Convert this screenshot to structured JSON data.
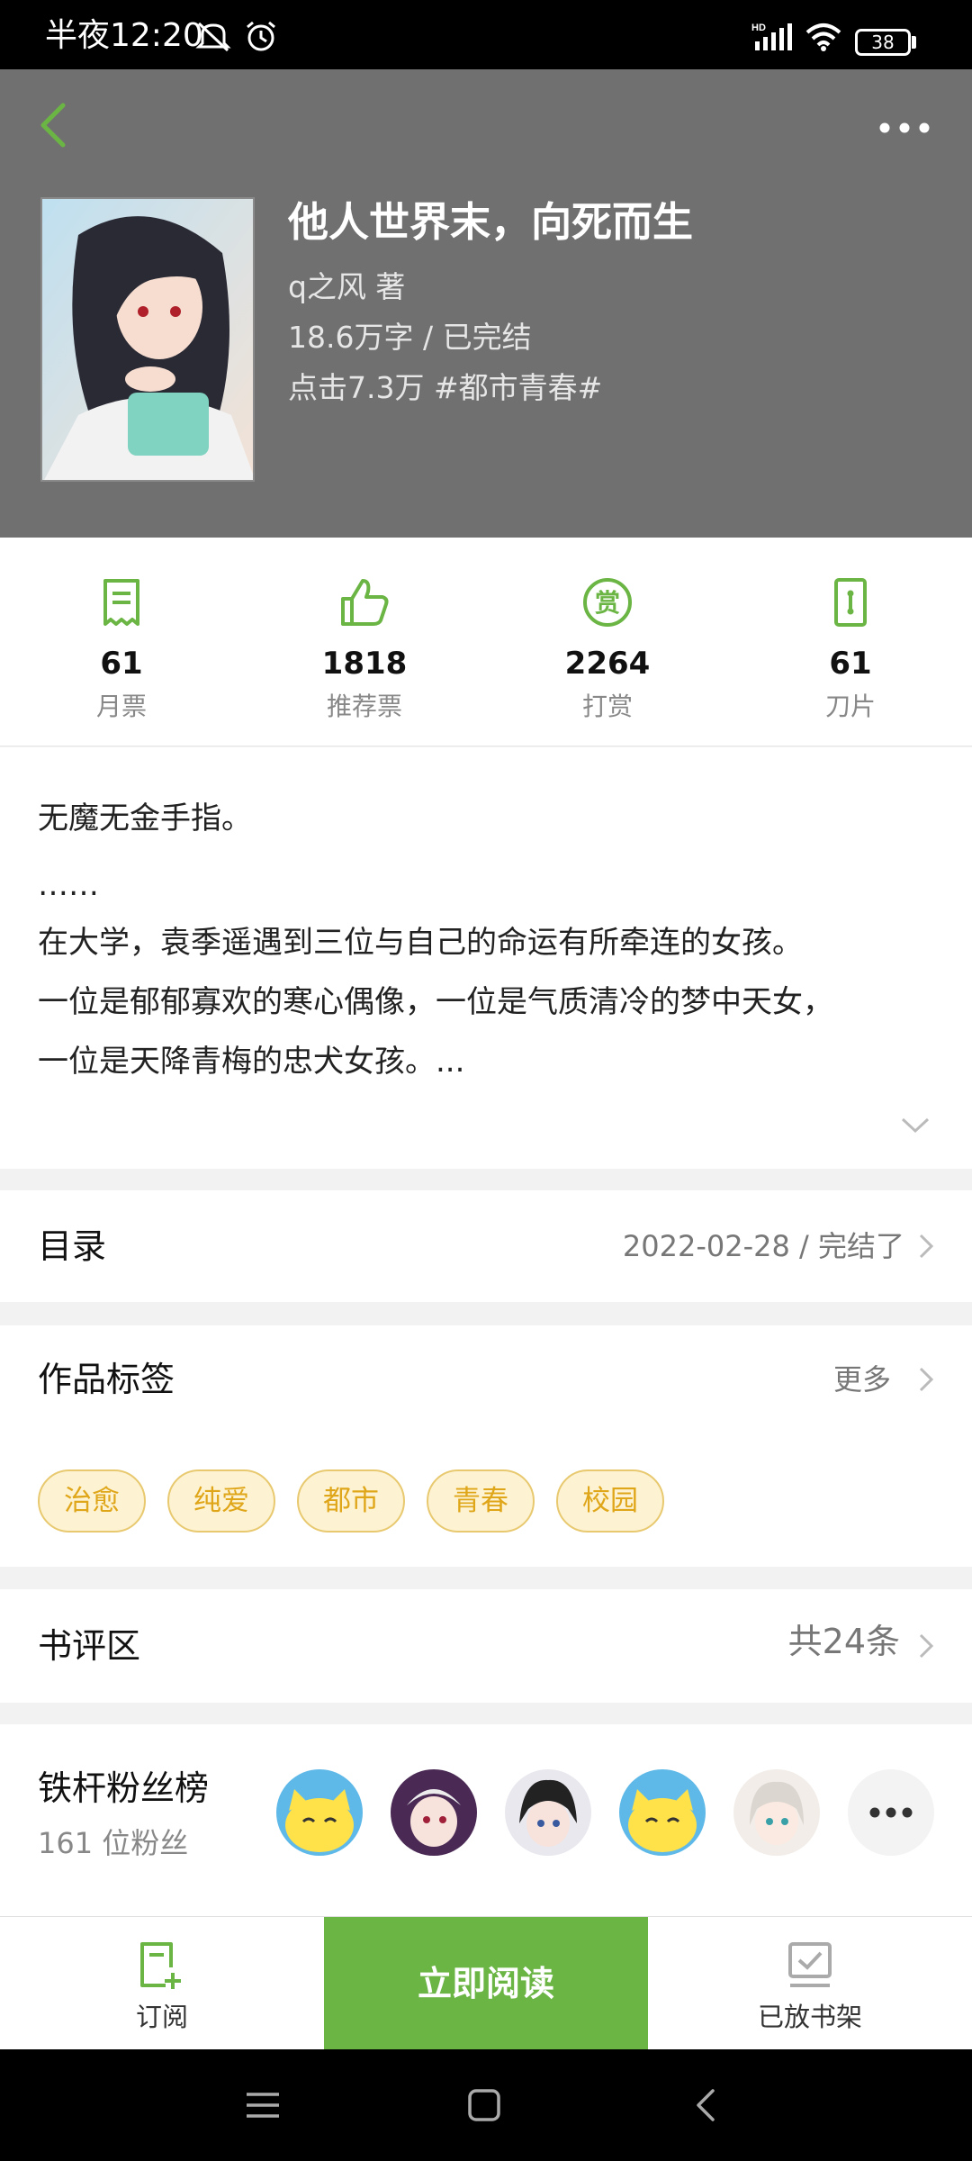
{
  "status_bar": {
    "time": "半夜12:20",
    "battery": "38"
  },
  "book": {
    "title": "他人世界末，向死而生",
    "author_line": "q之风  著",
    "length_status": "18.6万字 / 已完结",
    "clicks_genre": "点击7.3万  #都市青春#"
  },
  "stats": [
    {
      "value": "61",
      "label": "月票"
    },
    {
      "value": "1818",
      "label": "推荐票"
    },
    {
      "value": "2264",
      "label": "打赏"
    },
    {
      "value": "61",
      "label": "刀片"
    }
  ],
  "synopsis": [
    "无魔无金手指。",
    "……",
    "在大学，袁季遥遇到三位与自己的命运有所牵连的女孩。",
    "一位是郁郁寡欢的寒心偶像，一位是气质清冷的梦中天女，",
    "一位是天降青梅的忠犬女孩。..."
  ],
  "catalog": {
    "title": "目录",
    "info": "2022-02-28 / 完结了"
  },
  "tags_section": {
    "title": "作品标签",
    "more": "更多",
    "tags": [
      "治愈",
      "纯爱",
      "都市",
      "青春",
      "校园"
    ]
  },
  "reviews": {
    "title": "书评区",
    "count": "共24条"
  },
  "fans": {
    "title": "铁杆粉丝榜",
    "count": "161 位粉丝"
  },
  "bottom_bar": {
    "subscribe": "订阅",
    "read_now": "立即阅读",
    "shelved": "已放书架"
  },
  "colors": {
    "accent": "#6bb544",
    "header_bg": "#707070",
    "tag_text": "#e0a61a",
    "tag_bg": "#fdf3d3"
  }
}
